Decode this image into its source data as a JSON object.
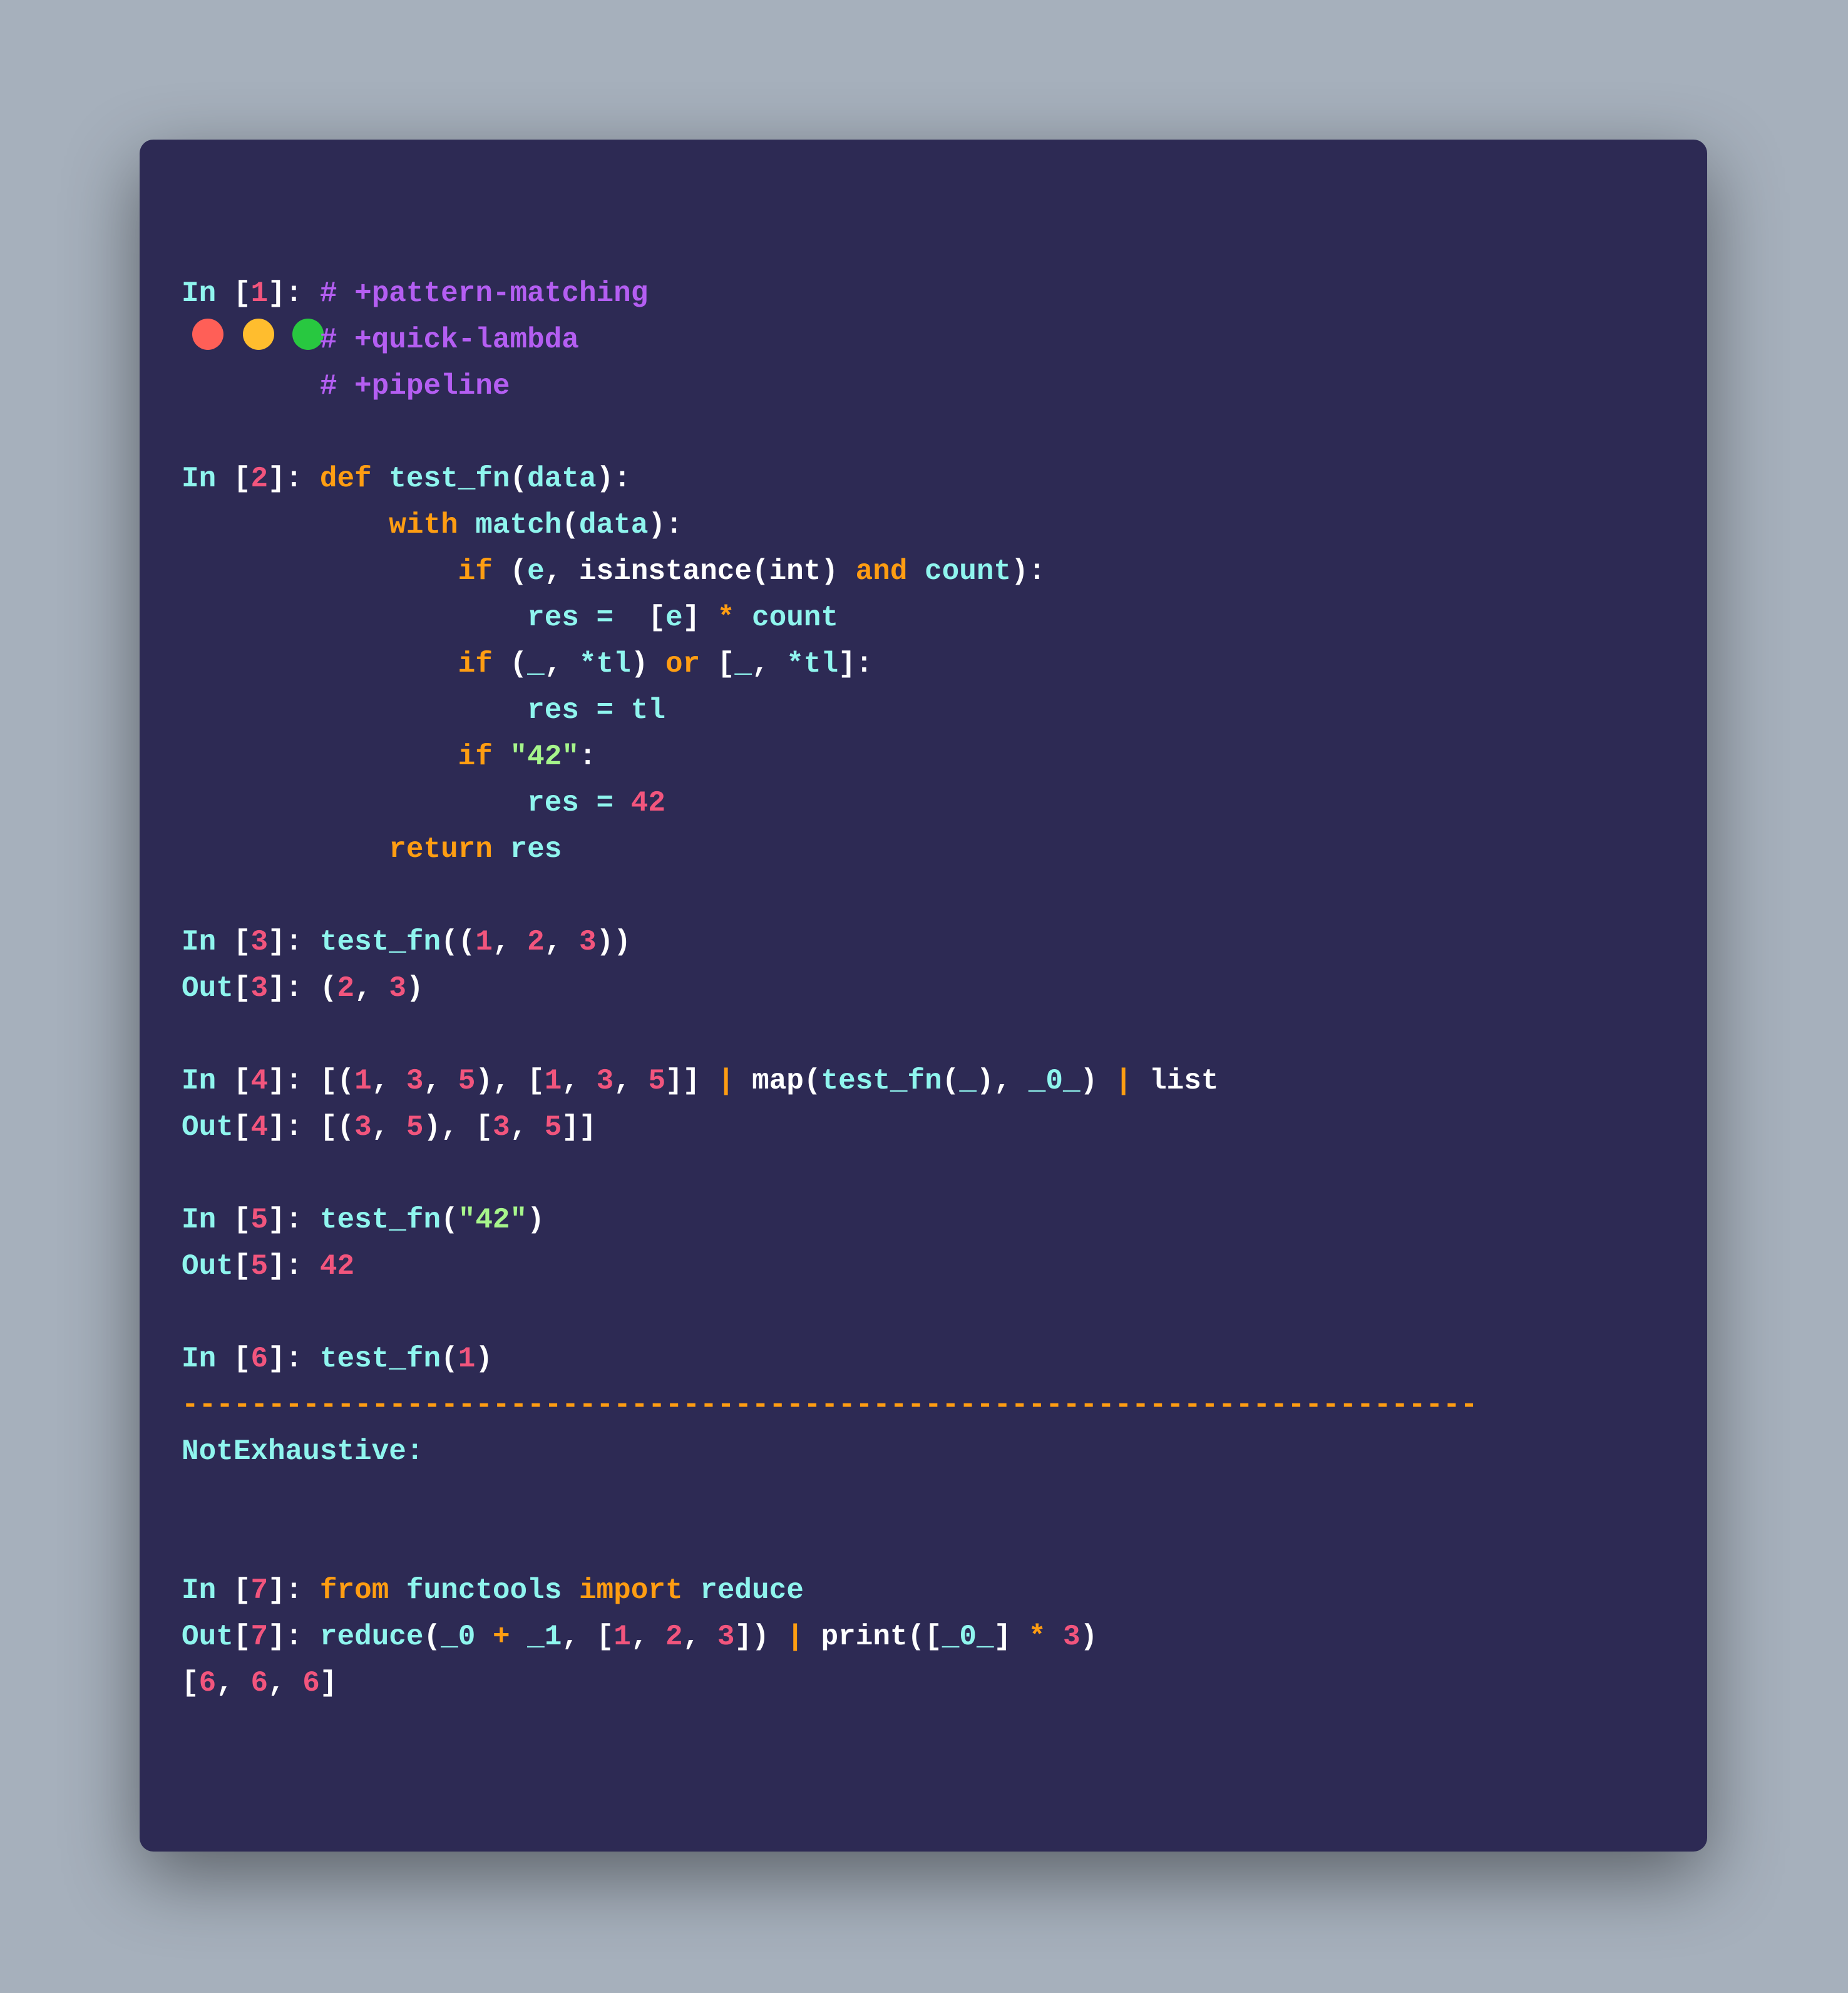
{
  "window": {
    "controls": [
      {
        "name": "close-button",
        "color": "#ff5f57"
      },
      {
        "name": "minimize-button",
        "color": "#ffbd2e"
      },
      {
        "name": "maximize-button",
        "color": "#28c840"
      }
    ]
  },
  "colors": {
    "background": "#2d2a54",
    "cyan": "#8ff5ee",
    "pink": "#f2557d",
    "orange": "#ff9d12",
    "purple": "#b45ef2",
    "green": "#a6f58b"
  },
  "lines": [
    [
      [
        "In ",
        "c"
      ],
      [
        "[",
        "w"
      ],
      [
        "1",
        "p"
      ],
      [
        "]: ",
        "w"
      ],
      [
        "# +pattern-matching",
        "u"
      ]
    ],
    [
      [
        "        # +quick-lambda",
        "u"
      ]
    ],
    [
      [
        "        # +pipeline",
        "u"
      ]
    ],
    [],
    [
      [
        "In ",
        "c"
      ],
      [
        "[",
        "w"
      ],
      [
        "2",
        "p"
      ],
      [
        "]: ",
        "w"
      ],
      [
        "def ",
        "o"
      ],
      [
        "test_fn",
        "c"
      ],
      [
        "(",
        "w"
      ],
      [
        "data",
        "c"
      ],
      [
        "):",
        "w"
      ]
    ],
    [
      [
        "            with ",
        "o"
      ],
      [
        "match",
        "c"
      ],
      [
        "(",
        "w"
      ],
      [
        "data",
        "c"
      ],
      [
        "):",
        "w"
      ]
    ],
    [
      [
        "                if ",
        "o"
      ],
      [
        "(",
        "w"
      ],
      [
        "e",
        "c"
      ],
      [
        ", isinstance(int) ",
        "w"
      ],
      [
        "and ",
        "o"
      ],
      [
        "count",
        "c"
      ],
      [
        "):",
        "w"
      ]
    ],
    [
      [
        "                    res =  ",
        "c"
      ],
      [
        "[",
        "w"
      ],
      [
        "e",
        "c"
      ],
      [
        "] ",
        "w"
      ],
      [
        "* ",
        "o"
      ],
      [
        "count",
        "c"
      ]
    ],
    [
      [
        "                if ",
        "o"
      ],
      [
        "(",
        "w"
      ],
      [
        "_",
        "c"
      ],
      [
        ", ",
        "w"
      ],
      [
        "*tl",
        "c"
      ],
      [
        ") ",
        "w"
      ],
      [
        "or ",
        "o"
      ],
      [
        "[",
        "w"
      ],
      [
        "_",
        "c"
      ],
      [
        ", ",
        "w"
      ],
      [
        "*tl",
        "c"
      ],
      [
        "]:",
        "w"
      ]
    ],
    [
      [
        "                    res = tl",
        "c"
      ]
    ],
    [
      [
        "                if ",
        "o"
      ],
      [
        "\"42\"",
        "g"
      ],
      [
        ":",
        "w"
      ]
    ],
    [
      [
        "                    res = ",
        "c"
      ],
      [
        "42",
        "p"
      ]
    ],
    [
      [
        "            return ",
        "o"
      ],
      [
        "res",
        "c"
      ]
    ],
    [],
    [
      [
        "In ",
        "c"
      ],
      [
        "[",
        "w"
      ],
      [
        "3",
        "p"
      ],
      [
        "]: ",
        "w"
      ],
      [
        "test_fn",
        "c"
      ],
      [
        "((",
        "w"
      ],
      [
        "1",
        "p"
      ],
      [
        ", ",
        "w"
      ],
      [
        "2",
        "p"
      ],
      [
        ", ",
        "w"
      ],
      [
        "3",
        "p"
      ],
      [
        "))",
        "w"
      ]
    ],
    [
      [
        "Out",
        "c"
      ],
      [
        "[",
        "w"
      ],
      [
        "3",
        "p"
      ],
      [
        "]: ",
        "w"
      ],
      [
        "(",
        "w"
      ],
      [
        "2",
        "p"
      ],
      [
        ", ",
        "w"
      ],
      [
        "3",
        "p"
      ],
      [
        ")",
        "w"
      ]
    ],
    [],
    [
      [
        "In ",
        "c"
      ],
      [
        "[",
        "w"
      ],
      [
        "4",
        "p"
      ],
      [
        "]: ",
        "w"
      ],
      [
        "[(",
        "w"
      ],
      [
        "1",
        "p"
      ],
      [
        ", ",
        "w"
      ],
      [
        "3",
        "p"
      ],
      [
        ", ",
        "w"
      ],
      [
        "5",
        "p"
      ],
      [
        "), [",
        "w"
      ],
      [
        "1",
        "p"
      ],
      [
        ", ",
        "w"
      ],
      [
        "3",
        "p"
      ],
      [
        ", ",
        "w"
      ],
      [
        "5",
        "p"
      ],
      [
        "]] ",
        "w"
      ],
      [
        "| ",
        "o"
      ],
      [
        "map(",
        "w"
      ],
      [
        "test_fn",
        "c"
      ],
      [
        "(",
        "w"
      ],
      [
        "_",
        "c"
      ],
      [
        "), ",
        "w"
      ],
      [
        "_0_",
        "c"
      ],
      [
        ") ",
        "w"
      ],
      [
        "| ",
        "o"
      ],
      [
        "list",
        "w"
      ]
    ],
    [
      [
        "Out",
        "c"
      ],
      [
        "[",
        "w"
      ],
      [
        "4",
        "p"
      ],
      [
        "]: ",
        "w"
      ],
      [
        "[(",
        "w"
      ],
      [
        "3",
        "p"
      ],
      [
        ", ",
        "w"
      ],
      [
        "5",
        "p"
      ],
      [
        "), [",
        "w"
      ],
      [
        "3",
        "p"
      ],
      [
        ", ",
        "w"
      ],
      [
        "5",
        "p"
      ],
      [
        "]]",
        "w"
      ]
    ],
    [],
    [
      [
        "In ",
        "c"
      ],
      [
        "[",
        "w"
      ],
      [
        "5",
        "p"
      ],
      [
        "]: ",
        "w"
      ],
      [
        "test_fn",
        "c"
      ],
      [
        "(",
        "w"
      ],
      [
        "\"42\"",
        "g"
      ],
      [
        ")",
        "w"
      ]
    ],
    [
      [
        "Out",
        "c"
      ],
      [
        "[",
        "w"
      ],
      [
        "5",
        "p"
      ],
      [
        "]: ",
        "w"
      ],
      [
        "42",
        "p"
      ]
    ],
    [],
    [
      [
        "In ",
        "c"
      ],
      [
        "[",
        "w"
      ],
      [
        "6",
        "p"
      ],
      [
        "]: ",
        "w"
      ],
      [
        "test_fn",
        "c"
      ],
      [
        "(",
        "w"
      ],
      [
        "1",
        "p"
      ],
      [
        ")",
        "w"
      ]
    ],
    [
      [
        "---------------------------------------------------------------------------",
        "o"
      ]
    ],
    [
      [
        "NotExhaustive:",
        "c"
      ]
    ],
    [],
    [],
    [
      [
        "In ",
        "c"
      ],
      [
        "[",
        "w"
      ],
      [
        "7",
        "p"
      ],
      [
        "]: ",
        "w"
      ],
      [
        "from ",
        "o"
      ],
      [
        "functools ",
        "c"
      ],
      [
        "import ",
        "o"
      ],
      [
        "reduce",
        "c"
      ]
    ],
    [
      [
        "Out",
        "c"
      ],
      [
        "[",
        "w"
      ],
      [
        "7",
        "p"
      ],
      [
        "]: ",
        "w"
      ],
      [
        "reduce",
        "c"
      ],
      [
        "(",
        "w"
      ],
      [
        "_0 ",
        "c"
      ],
      [
        "+ ",
        "o"
      ],
      [
        "_1",
        "c"
      ],
      [
        ", [",
        "w"
      ],
      [
        "1",
        "p"
      ],
      [
        ", ",
        "w"
      ],
      [
        "2",
        "p"
      ],
      [
        ", ",
        "w"
      ],
      [
        "3",
        "p"
      ],
      [
        "]) ",
        "w"
      ],
      [
        "| ",
        "o"
      ],
      [
        "print([",
        "w"
      ],
      [
        "_0_",
        "c"
      ],
      [
        "] ",
        "w"
      ],
      [
        "* ",
        "o"
      ],
      [
        "3",
        "p"
      ],
      [
        ")",
        "w"
      ]
    ],
    [
      [
        "[",
        "w"
      ],
      [
        "6",
        "p"
      ],
      [
        ", ",
        "w"
      ],
      [
        "6",
        "p"
      ],
      [
        ", ",
        "w"
      ],
      [
        "6",
        "p"
      ],
      [
        "]",
        "w"
      ]
    ]
  ]
}
